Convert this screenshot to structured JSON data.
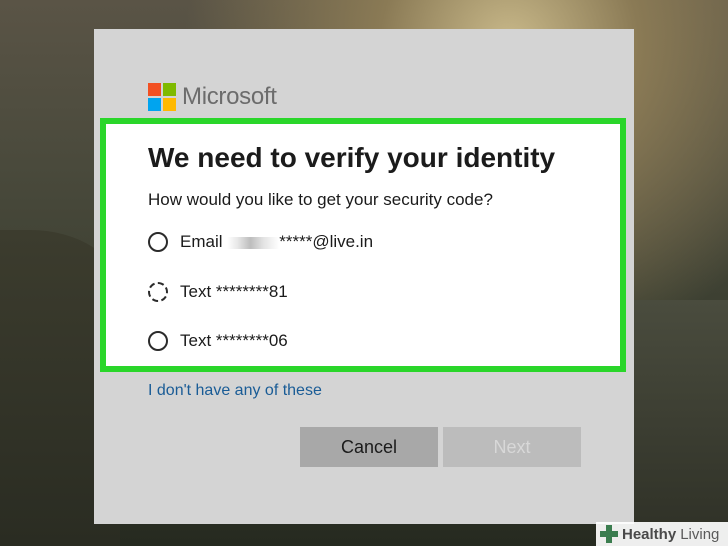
{
  "brand": {
    "name": "Microsoft",
    "logo_colors": [
      "#f25022",
      "#7fba00",
      "#00a4ef",
      "#ffb900"
    ]
  },
  "accent_colors": {
    "highlight": "#2ad62a",
    "link": "#1a5c96"
  },
  "dialog": {
    "title": "We need to verify your identity",
    "question": "How would you like to get your security code?",
    "options": [
      {
        "prefix": "Email ",
        "masked": true,
        "suffix": "*****@live.in",
        "selected": false
      },
      {
        "label": "Text ********81",
        "selected": false,
        "focused": true
      },
      {
        "label": "Text ********06",
        "selected": false
      }
    ],
    "alt_link": "I don't have any of these",
    "cancel_label": "Cancel",
    "next_label": "Next",
    "next_enabled": false
  },
  "watermark": {
    "brand": "Healthy",
    "suffix": "Living",
    "icon": "plus-cross-icon"
  }
}
